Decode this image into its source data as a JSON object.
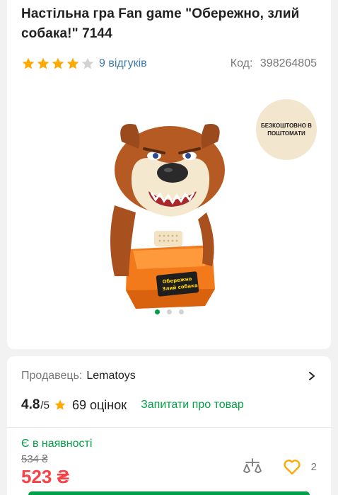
{
  "product": {
    "title": "Настільна гра Fan game \"Обережно, злий собака!\" 7144",
    "rating_stars": 4,
    "rating_max": 5,
    "reviews_label": "9 відгуків",
    "code_label": "Код:",
    "code_value": "398264805"
  },
  "gallery": {
    "promo_badge": "БЕЗКОШТОВНО В ПОШТОМАТИ",
    "image_plate_text": "Обережно Злий собака",
    "slides": 3,
    "active_slide": 1
  },
  "seller": {
    "label": "Продавець:",
    "name": "Lematoys",
    "score": "4.8",
    "score_max": "/5",
    "votes": "69 оцінок",
    "ask_link": "Запитати про товар"
  },
  "offer": {
    "availability": "Є в наявності",
    "old_price": "534 ₴",
    "new_price": "523 ₴",
    "favorites_count": "2"
  },
  "colors": {
    "accent_green": "#00a046",
    "link_blue": "#3e77aa",
    "price_red": "#f84147",
    "star_gold": "#ffa900",
    "heart_orange": "#ffa900"
  }
}
